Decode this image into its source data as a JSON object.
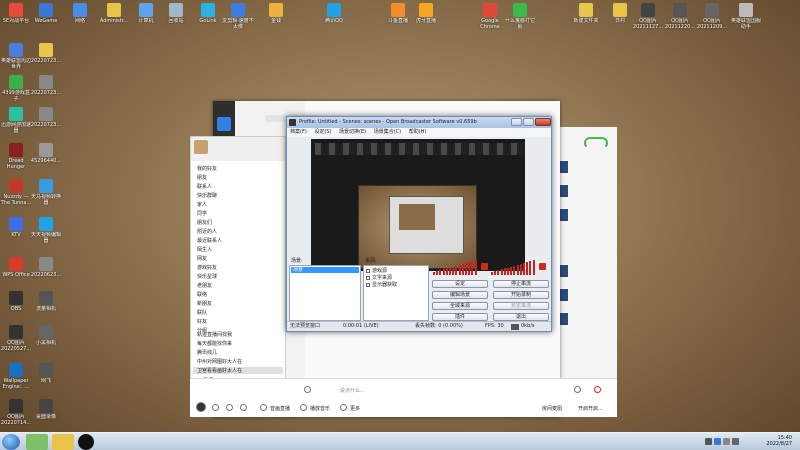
{
  "desktop": {
    "icons": [
      {
        "label": "5E对战平台",
        "color": "#e84b3c"
      },
      {
        "label": "WeGame",
        "color": "#3a77d9"
      },
      {
        "label": "网络",
        "color": "#4a8de8"
      },
      {
        "label": "Administr...",
        "color": "#e8c34a"
      },
      {
        "label": "计算机",
        "color": "#5ea4e8"
      },
      {
        "label": "回收站",
        "color": "#9fb8cc"
      },
      {
        "label": "GoLink",
        "color": "#2ab2e0"
      },
      {
        "label": "爱剪辑·速度不太慢",
        "color": "#3c7ee0"
      },
      {
        "label": "金钱",
        "color": "#f0b040"
      },
      {
        "label": "腾讯QQ",
        "color": "#22a0e8"
      },
      {
        "label": "斗鱼直播",
        "color": "#f48b2c"
      },
      {
        "label": "虎牙直播",
        "color": "#f5a623"
      },
      {
        "label": "Google Chrome",
        "color": "#e0483a"
      },
      {
        "label": "什么鬼都打它就",
        "color": "#3dbb4a"
      },
      {
        "label": "新建文件夹",
        "color": "#e8c64a"
      },
      {
        "label": "日村",
        "color": "#e8c64a"
      },
      {
        "label": "QQ图片 20211127...",
        "color": "#444"
      },
      {
        "label": "QQ图片 20211220...",
        "color": "#555"
      },
      {
        "label": "QQ图片 20211209...",
        "color": "#666"
      },
      {
        "label": "英雄联盟国服助手",
        "color": "#bbb"
      },
      {
        "label": "英雄联盟周边世界",
        "color": "#4a7fd9"
      },
      {
        "label": "20220723...",
        "color": "#e8c64a"
      },
      {
        "label": "4399游戏盒子",
        "color": "#3bb04a"
      },
      {
        "label": "20220723...",
        "color": "#888"
      },
      {
        "label": "迅游网游加速器",
        "color": "#2cc0a0"
      },
      {
        "label": "20220723...",
        "color": "#888"
      },
      {
        "label": "Dread Hunger",
        "color": "#8a1f1f"
      },
      {
        "label": "45296440...",
        "color": "#999"
      },
      {
        "label": "Nuzzdy — The Tunna...",
        "color": "#c0392b"
      },
      {
        "label": "天马视频转换器",
        "color": "#3a9be0"
      },
      {
        "label": "KTV",
        "color": "#3a6fe0"
      },
      {
        "label": "天天视频编辑器",
        "color": "#22a0e8"
      },
      {
        "label": "WPS Office",
        "color": "#d63a2b"
      },
      {
        "label": "20220623...",
        "color": "#888"
      },
      {
        "label": "OBS",
        "color": "#333"
      },
      {
        "label": "流量相机",
        "color": "#555"
      },
      {
        "label": "QQ图片 20220527...",
        "color": "#333"
      },
      {
        "label": "小黑相机",
        "color": "#666"
      },
      {
        "label": "Wallpaper Engine：...",
        "color": "#1d6fc2"
      },
      {
        "label": "网飞",
        "color": "#555"
      },
      {
        "label": "QQ图片 20220714...",
        "color": "#333"
      },
      {
        "label": "桌面录像",
        "color": "#444"
      }
    ]
  },
  "obs": {
    "title": "Profile: Untitled - Scenes: scenes - Open Broadcaster Software v0.659b",
    "menu": [
      "档案(F)",
      "设定(S)",
      "场景切换(E)",
      "场景集合(C)",
      "帮助(H)"
    ],
    "scenes_label": "场景:",
    "sources_label": "来源:",
    "scenes": [
      "场景"
    ],
    "sources": [
      "游戏源",
      "文字来源",
      "显示器获取"
    ],
    "buttons": {
      "settings": "设定",
      "stop_stream": "停止串流",
      "edit_scene": "编辑场景",
      "start_recording": "开始录制",
      "global_sources": "全域来源",
      "preview_stream": "预览串流",
      "plugins": "插件",
      "exit": "退出"
    },
    "status": {
      "mode": "无法预览窗口",
      "time": "0:00:01 (LIVE)",
      "dropped": "丢失帧数: 0 (0.00%)",
      "fps": "FPS: 30",
      "bitrate": "0kb/s"
    }
  },
  "qq": {
    "conversations": [
      {
        "name": "后村策定",
        "color": "#c0392b"
      },
      {
        "name": "下载QQ说",
        "color": "#7d5a3c"
      },
      {
        "name": "订阅号",
        "color": "#2d7fe0"
      },
      {
        "name": "文件传输",
        "color": "#3bb04a"
      },
      {
        "name": "欧柳",
        "color": "#222"
      },
      {
        "name": "枫叶云菜",
        "color": "#8a5c3a"
      },
      {
        "name": "吉朋山 审",
        "color": "#444"
      },
      {
        "name": "浪浪 编",
        "color": "#666"
      }
    ],
    "friend_groups": [
      "我的好友",
      "朋友",
      "联系人",
      "快乐群聊",
      "家人",
      "同学",
      "朋友们",
      "附近的人",
      "最近联系人",
      "陌生人",
      "网友",
      "游戏好友",
      "快乐星球",
      "老朋友",
      "联络",
      "新朋友",
      "联队",
      "好友",
      "分组"
    ],
    "bottom_groups": [
      "轨迹直播间找我",
      "每天都能找你来",
      "腾讯线几",
      "中州对网图好大人在",
      "卫宫看看画好太人在"
    ],
    "member_rows": [
      {
        "name": "5e",
        "color": "#f0a020"
      },
      {
        "name": "老师",
        "color": "#3a77d9"
      },
      {
        "name": "马扶龙 9.6.8",
        "color": "#e05020"
      }
    ],
    "chat_placeholder": "说点什么...",
    "chatbar_items": {
      "voice": "音画直播",
      "music": "播放音乐",
      "more": "更多"
    },
    "chatbar_right": {
      "speakers": "房间麦阻",
      "mic": "开启开启..."
    }
  },
  "taskbar": {
    "time": "15:40",
    "date": "2022/8/27"
  }
}
